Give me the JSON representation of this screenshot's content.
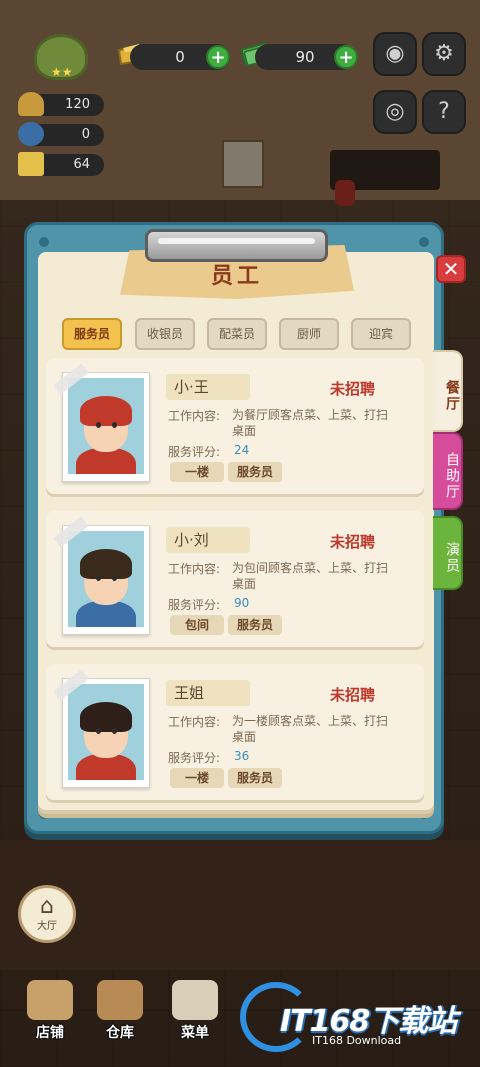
{
  "hud": {
    "gold": "0",
    "cash": "90",
    "stats": [
      "120",
      "0",
      "64"
    ],
    "camera_icon": "camera-icon",
    "settings_icon": "gear-icon",
    "view_icon": "eye-icon",
    "help_icon": "book-question-icon"
  },
  "dialog": {
    "title": "员工",
    "close_label": "✕",
    "tabs": [
      {
        "label": "服务员",
        "active": true
      },
      {
        "label": "收银员",
        "active": false
      },
      {
        "label": "配菜员",
        "active": false
      },
      {
        "label": "厨师",
        "active": false
      },
      {
        "label": "迎宾",
        "active": false
      }
    ],
    "side_tabs": [
      "餐厅",
      "自助厅",
      "演员"
    ],
    "job_label": "工作内容:",
    "score_label": "服务评分:",
    "staff": [
      {
        "name": "小·王",
        "status": "未招聘",
        "desc": "为餐厅顾客点菜、上菜、打扫桌面",
        "score": "24",
        "floor": "一楼",
        "role": "服务员",
        "hair": "#c0392b"
      },
      {
        "name": "小·刘",
        "status": "未招聘",
        "desc": "为包间顾客点菜、上菜、打扫桌面",
        "score": "90",
        "floor": "包间",
        "role": "服务员",
        "hair": "#3a2a1c"
      },
      {
        "name": "王姐",
        "status": "未招聘",
        "desc": "为一楼顾客点菜、上菜、打扫桌面",
        "score": "36",
        "floor": "一楼",
        "role": "服务员",
        "hair": "#2e2018"
      }
    ]
  },
  "bottom": {
    "hall_label": "大厅",
    "items": [
      "店铺",
      "仓库",
      "菜单"
    ]
  },
  "watermark": {
    "text": "IT168下载站",
    "sub": "IT168 Download"
  }
}
